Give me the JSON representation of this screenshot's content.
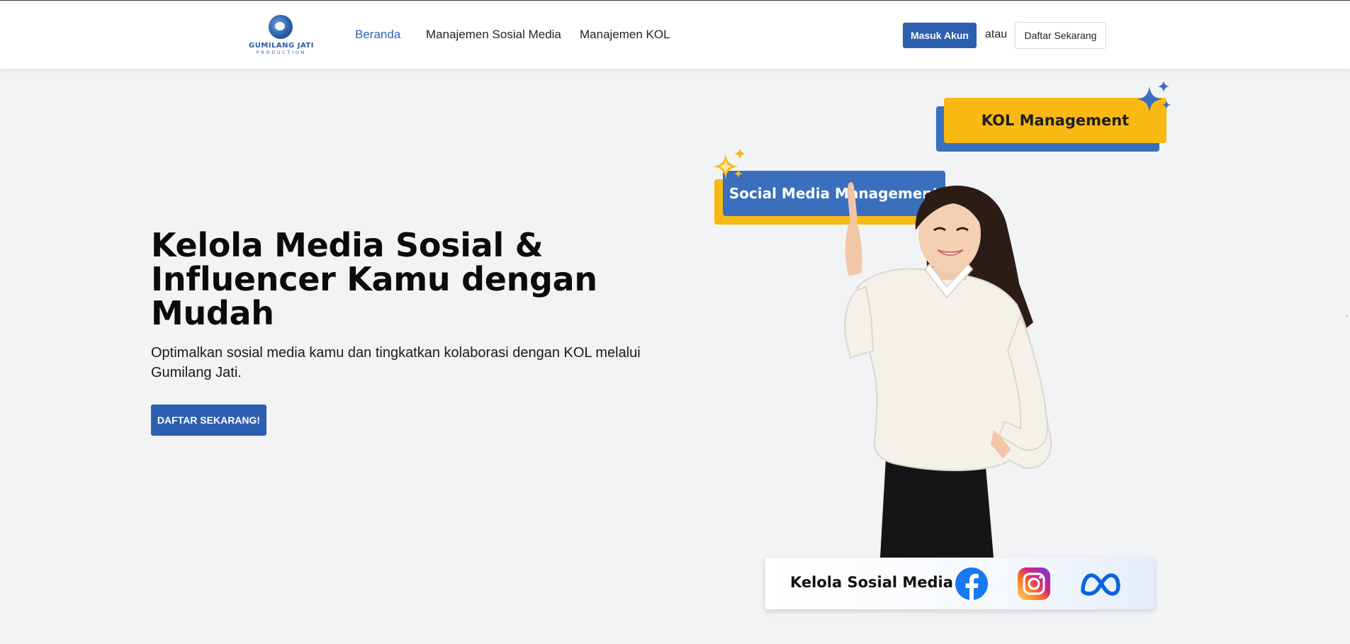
{
  "navbar": {
    "logo_name": "GUMILANG JATI",
    "logo_sub": "PRODUCTION",
    "links": [
      {
        "label": "Beranda",
        "active": true
      },
      {
        "label": "Manajemen Sosial Media",
        "active": false
      },
      {
        "label": "Manajemen KOL",
        "active": false
      }
    ],
    "login_label": "Masuk Akun",
    "or_label": "atau",
    "register_label": "Daftar Sekarang"
  },
  "hero": {
    "title": "Kelola Media Sosial & Influencer Kamu dengan Mudah",
    "description": "Optimalkan sosial media kamu dan tingkatkan kolaborasi dengan KOL melalui Gumilang Jati.",
    "cta_label": "DAFTAR SEKARANG!"
  },
  "illustration": {
    "tag_kol": "KOL Management",
    "tag_social": "Social Media Management",
    "social_card_label": "Kelola Sosial Media",
    "icons": [
      "facebook-icon",
      "instagram-icon",
      "meta-icon"
    ]
  },
  "colors": {
    "primary": "#2c5fb0",
    "accent_yellow": "#f8b912",
    "tag_blue": "#3a6fbe",
    "background": "#f2f3f5"
  }
}
